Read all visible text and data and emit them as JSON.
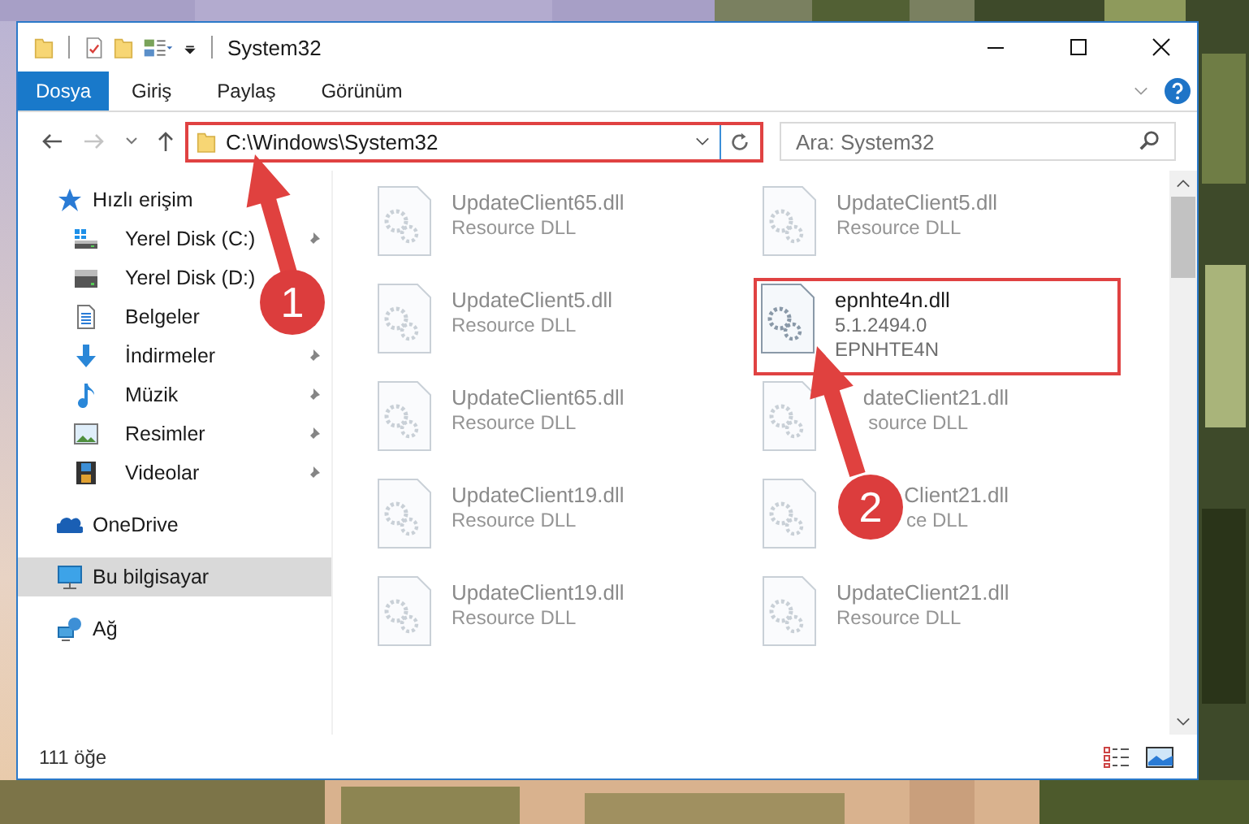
{
  "window": {
    "title": "System32"
  },
  "ribbon_tabs": [
    {
      "label": "Dosya",
      "selected": true
    },
    {
      "label": "Giriş",
      "selected": false
    },
    {
      "label": "Paylaş",
      "selected": false
    },
    {
      "label": "Görünüm",
      "selected": false
    }
  ],
  "address": {
    "path": "C:\\Windows\\System32",
    "highlighted": true
  },
  "search": {
    "placeholder": "Ara: System32"
  },
  "sidebar": {
    "items": [
      {
        "label": "Hızlı erişim",
        "kind": "star",
        "selected": false,
        "children": [
          {
            "label": "Yerel Disk (C:)",
            "kind": "system-drive",
            "selected": false,
            "pinned": true
          },
          {
            "label": "Yerel Disk (D:)",
            "kind": "drive",
            "selected": false
          },
          {
            "label": "Belgeler",
            "kind": "document",
            "selected": false
          },
          {
            "label": "İndirmeler",
            "kind": "download",
            "selected": false,
            "pinned": true
          },
          {
            "label": "Müzik",
            "kind": "music",
            "selected": false,
            "pinned": true
          },
          {
            "label": "Resimler",
            "kind": "pictures",
            "selected": false,
            "pinned": true
          },
          {
            "label": "Videolar",
            "kind": "video",
            "selected": false,
            "pinned": true
          }
        ]
      },
      {
        "label": "OneDrive",
        "kind": "cloud",
        "selected": false
      },
      {
        "label": "Bu bilgisayar",
        "kind": "computer",
        "selected": true
      },
      {
        "label": "Ağ",
        "kind": "network",
        "selected": false
      }
    ]
  },
  "files": [
    {
      "name": "UpdateClient65.dll",
      "details": [
        "Resource DLL"
      ],
      "blurred": true,
      "highlighted": false,
      "cut_start": false
    },
    {
      "name": "UpdateClient5.dll",
      "details": [
        "Resource DLL"
      ],
      "blurred": true,
      "highlighted": false,
      "cut_start": false
    },
    {
      "name": "UpdateClient5.dll",
      "details": [
        "Resource DLL"
      ],
      "blurred": true,
      "highlighted": false,
      "cut_start": false
    },
    {
      "name": "epnhte4n.dll",
      "details": [
        "5.1.2494.0",
        "EPNHTE4N"
      ],
      "blurred": false,
      "highlighted": true,
      "cut_start": false
    },
    {
      "name": "UpdateClient65.dll",
      "details": [
        "Resource DLL"
      ],
      "blurred": true,
      "highlighted": false,
      "cut_start": false
    },
    {
      "name": "dateClient21.dll",
      "details": [
        "source DLL"
      ],
      "blurred": true,
      "highlighted": false,
      "cut_start": true
    },
    {
      "name": "UpdateClient19.dll",
      "details": [
        "Resource DLL"
      ],
      "blurred": true,
      "highlighted": false,
      "cut_start": false
    },
    {
      "name": "Client21.dll",
      "details": [
        "ce DLL"
      ],
      "blurred": true,
      "highlighted": false,
      "cut_start": true
    },
    {
      "name": "UpdateClient19.dll",
      "details": [
        "Resource DLL"
      ],
      "blurred": true,
      "highlighted": false,
      "cut_start": false
    },
    {
      "name": "UpdateClient21.dll",
      "details": [
        "Resource DLL"
      ],
      "blurred": true,
      "highlighted": false,
      "cut_start": false
    }
  ],
  "status_bar": {
    "item_count": "111 öğe"
  },
  "callouts": [
    {
      "number": "1"
    },
    {
      "number": "2"
    }
  ]
}
